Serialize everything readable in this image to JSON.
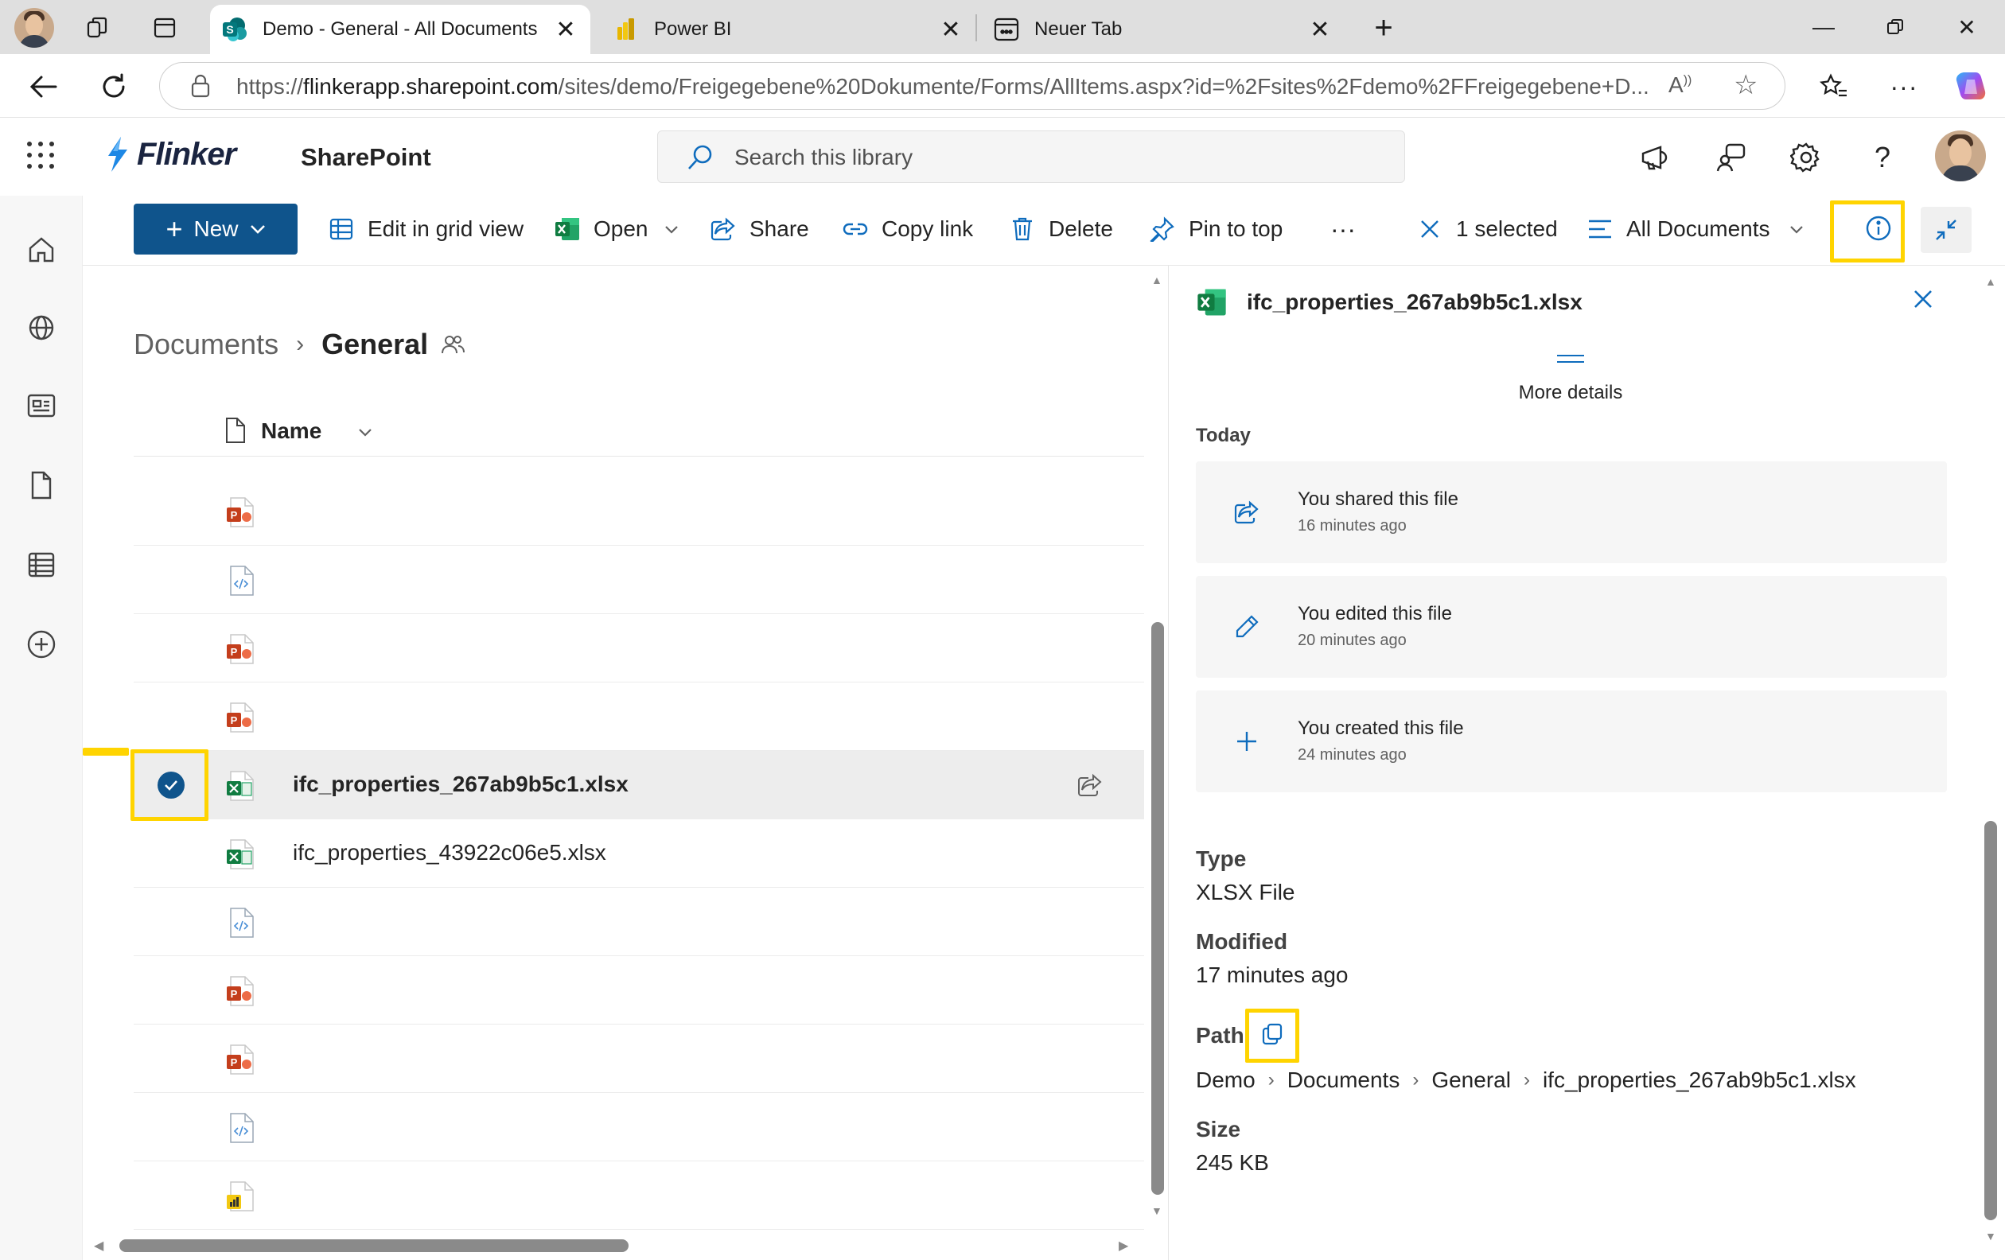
{
  "browser": {
    "tabs": [
      {
        "title": "Demo - General - All Documents",
        "active": true
      },
      {
        "title": "Power BI",
        "active": false
      },
      {
        "title": "Neuer Tab",
        "active": false
      }
    ],
    "url_prefix": "https://",
    "url_host": "flinkerapp.sharepoint.com",
    "url_path": "/sites/demo/Freigegebene%20Dokumente/Forms/AllItems.aspx?id=%2Fsites%2Fdemo%2FFreigegebene+D..."
  },
  "suite": {
    "brand": "Flinker",
    "site": "SharePoint",
    "search_placeholder": "Search this library"
  },
  "commands": {
    "new": "New",
    "edit_grid": "Edit in grid view",
    "open": "Open",
    "share": "Share",
    "copy_link": "Copy link",
    "delete": "Delete",
    "pin": "Pin to top",
    "more": "···",
    "selected": "1 selected",
    "view": "All Documents"
  },
  "breadcrumb": {
    "root": "Documents",
    "current": "General"
  },
  "list": {
    "name_header": "Name",
    "rows": [
      {
        "type": "pptx",
        "name": ""
      },
      {
        "type": "code",
        "name": ""
      },
      {
        "type": "pptx",
        "name": ""
      },
      {
        "type": "pptx",
        "name": ""
      },
      {
        "type": "xlsx",
        "name": "ifc_properties_267ab9b5c1.xlsx",
        "selected": true
      },
      {
        "type": "xlsx",
        "name": "ifc_properties_43922c06e5.xlsx"
      },
      {
        "type": "code",
        "name": ""
      },
      {
        "type": "pptx",
        "name": ""
      },
      {
        "type": "pptx",
        "name": ""
      },
      {
        "type": "code",
        "name": ""
      },
      {
        "type": "pbix",
        "name": ""
      }
    ]
  },
  "details": {
    "file_name": "ifc_properties_267ab9b5c1.xlsx",
    "more_details": "More details",
    "today": "Today",
    "activities": [
      {
        "icon": "share-icon",
        "title": "You shared this file",
        "time": "16 minutes ago"
      },
      {
        "icon": "pencil-icon",
        "title": "You edited this file",
        "time": "20 minutes ago"
      },
      {
        "icon": "plus-icon",
        "title": "You created this file",
        "time": "24 minutes ago"
      }
    ],
    "type_label": "Type",
    "type_value": "XLSX File",
    "modified_label": "Modified",
    "modified_value": "17 minutes ago",
    "path_label": "Path",
    "path": [
      "Demo",
      "Documents",
      "General",
      "ifc_properties_267ab9b5c1.xlsx"
    ],
    "size_label": "Size",
    "size_value": "245 KB"
  },
  "colors": {
    "accent": "#0f548c",
    "highlight": "#ffd400",
    "excel": "#107c41",
    "powerpoint": "#c43e1c"
  }
}
